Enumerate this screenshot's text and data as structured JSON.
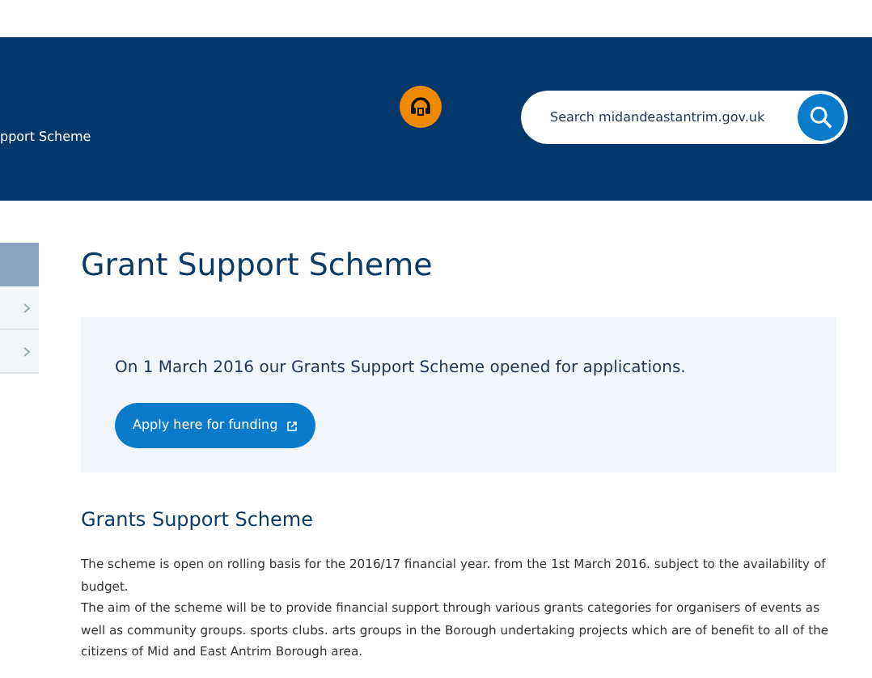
{
  "header": {
    "breadcrumb": "pport Scheme",
    "search": {
      "placeholder": "Search midandeastantrim.gov.uk"
    }
  },
  "sidebar": {
    "items": [
      {
        "selected": true
      },
      {
        "selected": false
      },
      {
        "selected": false
      }
    ]
  },
  "main": {
    "title": "Grant Support Scheme",
    "notice": {
      "text": "On 1 March 2016 our Grants Support Scheme opened for applications.",
      "button": "Apply here for funding"
    },
    "section_title": "Grants Support Scheme",
    "paragraphs": [
      "The scheme is open on rolling basis for the 2016/17 financial year. from the 1st March 2016. subject to the availability of budget.",
      "The aim of the scheme will be to provide financial support through various grants categories for organisers of events as well as community groups. sports clubs. arts groups in the Borough undertaking projects which are of benefit to all of the citizens of Mid and East Antrim Borough area."
    ]
  }
}
